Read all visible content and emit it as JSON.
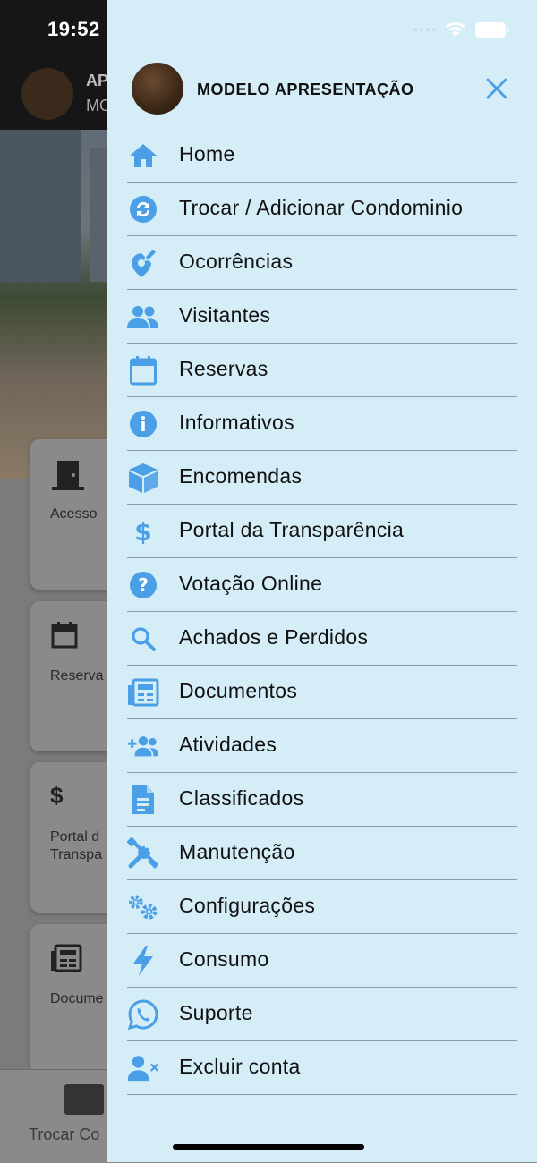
{
  "status": {
    "time": "19:52"
  },
  "background": {
    "header_title": "AP",
    "header_subtitle": "MO",
    "cards": [
      {
        "label": "Acesso",
        "icon": "door-icon"
      },
      {
        "label": "Reserva",
        "icon": "calendar-icon"
      },
      {
        "label": "Portal d Transpa",
        "icon": "dollar-icon"
      },
      {
        "label": "Docume",
        "icon": "newspaper-icon"
      }
    ],
    "bottom_tab_label": "Trocar Co"
  },
  "drawer": {
    "title": "MODELO APRESENTAÇÃO",
    "accent_color": "#4a9fe6",
    "menu": [
      {
        "label": "Home",
        "icon": "home-icon"
      },
      {
        "label": "Trocar / Adicionar Condominio",
        "icon": "sync-icon"
      },
      {
        "label": "Ocorrências",
        "icon": "map-pin-edit-icon"
      },
      {
        "label": "Visitantes",
        "icon": "people-icon"
      },
      {
        "label": "Reservas",
        "icon": "calendar-icon"
      },
      {
        "label": "Informativos",
        "icon": "info-icon"
      },
      {
        "label": "Encomendas",
        "icon": "box-icon"
      },
      {
        "label": "Portal da Transparência",
        "icon": "dollar-icon"
      },
      {
        "label": "Votação Online",
        "icon": "help-circle-icon"
      },
      {
        "label": "Achados e Perdidos",
        "icon": "search-icon"
      },
      {
        "label": "Documentos",
        "icon": "newspaper-icon"
      },
      {
        "label": "Atividades",
        "icon": "group-add-icon"
      },
      {
        "label": "Classificados",
        "icon": "document-icon"
      },
      {
        "label": "Manutenção",
        "icon": "tools-icon"
      },
      {
        "label": "Configurações",
        "icon": "gears-icon"
      },
      {
        "label": "Consumo",
        "icon": "lightning-icon"
      },
      {
        "label": "Suporte",
        "icon": "whatsapp-icon"
      },
      {
        "label": "Excluir conta",
        "icon": "user-remove-icon"
      }
    ]
  }
}
